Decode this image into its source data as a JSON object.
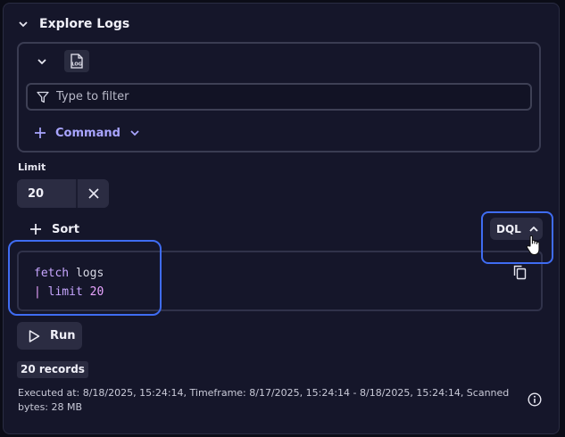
{
  "section": {
    "title": "Explore Logs"
  },
  "query": {
    "log_badge": "LOG",
    "filter_placeholder": "Type to filter",
    "command_label": "Command"
  },
  "limit": {
    "label": "Limit",
    "value": "20"
  },
  "sort": {
    "label": "Sort"
  },
  "dql": {
    "label": "DQL"
  },
  "code": {
    "line1_keyword": "fetch",
    "line1_rest": " logs",
    "line2_pipe": "| ",
    "line2_keyword": "limit",
    "line2_number": " 20"
  },
  "run": {
    "label": "Run"
  },
  "result": {
    "records": "20 records",
    "meta": "Executed at: 8/18/2025, 15:24:14, Timeframe: 8/17/2025, 15:24:14 - 8/18/2025, 15:24:14, Scanned bytes: 28 MB"
  },
  "icons": {
    "section_toggle": "chevron-down-icon",
    "query_toggle": "chevron-down-icon",
    "log_source": "log-icon",
    "filter": "filter-icon",
    "command_add": "plus-icon",
    "command_menu": "chevron-down-icon",
    "limit_clear": "close-icon",
    "sort_add": "plus-icon",
    "dql_toggle": "chevron-up-icon",
    "copy": "copy-icon",
    "run": "play-icon",
    "info": "info-icon",
    "cursor": "hand-pointer-icon"
  },
  "colors": {
    "accent": "#a9a5ff",
    "highlight": "#3f6cf2",
    "background": "#15162a"
  }
}
